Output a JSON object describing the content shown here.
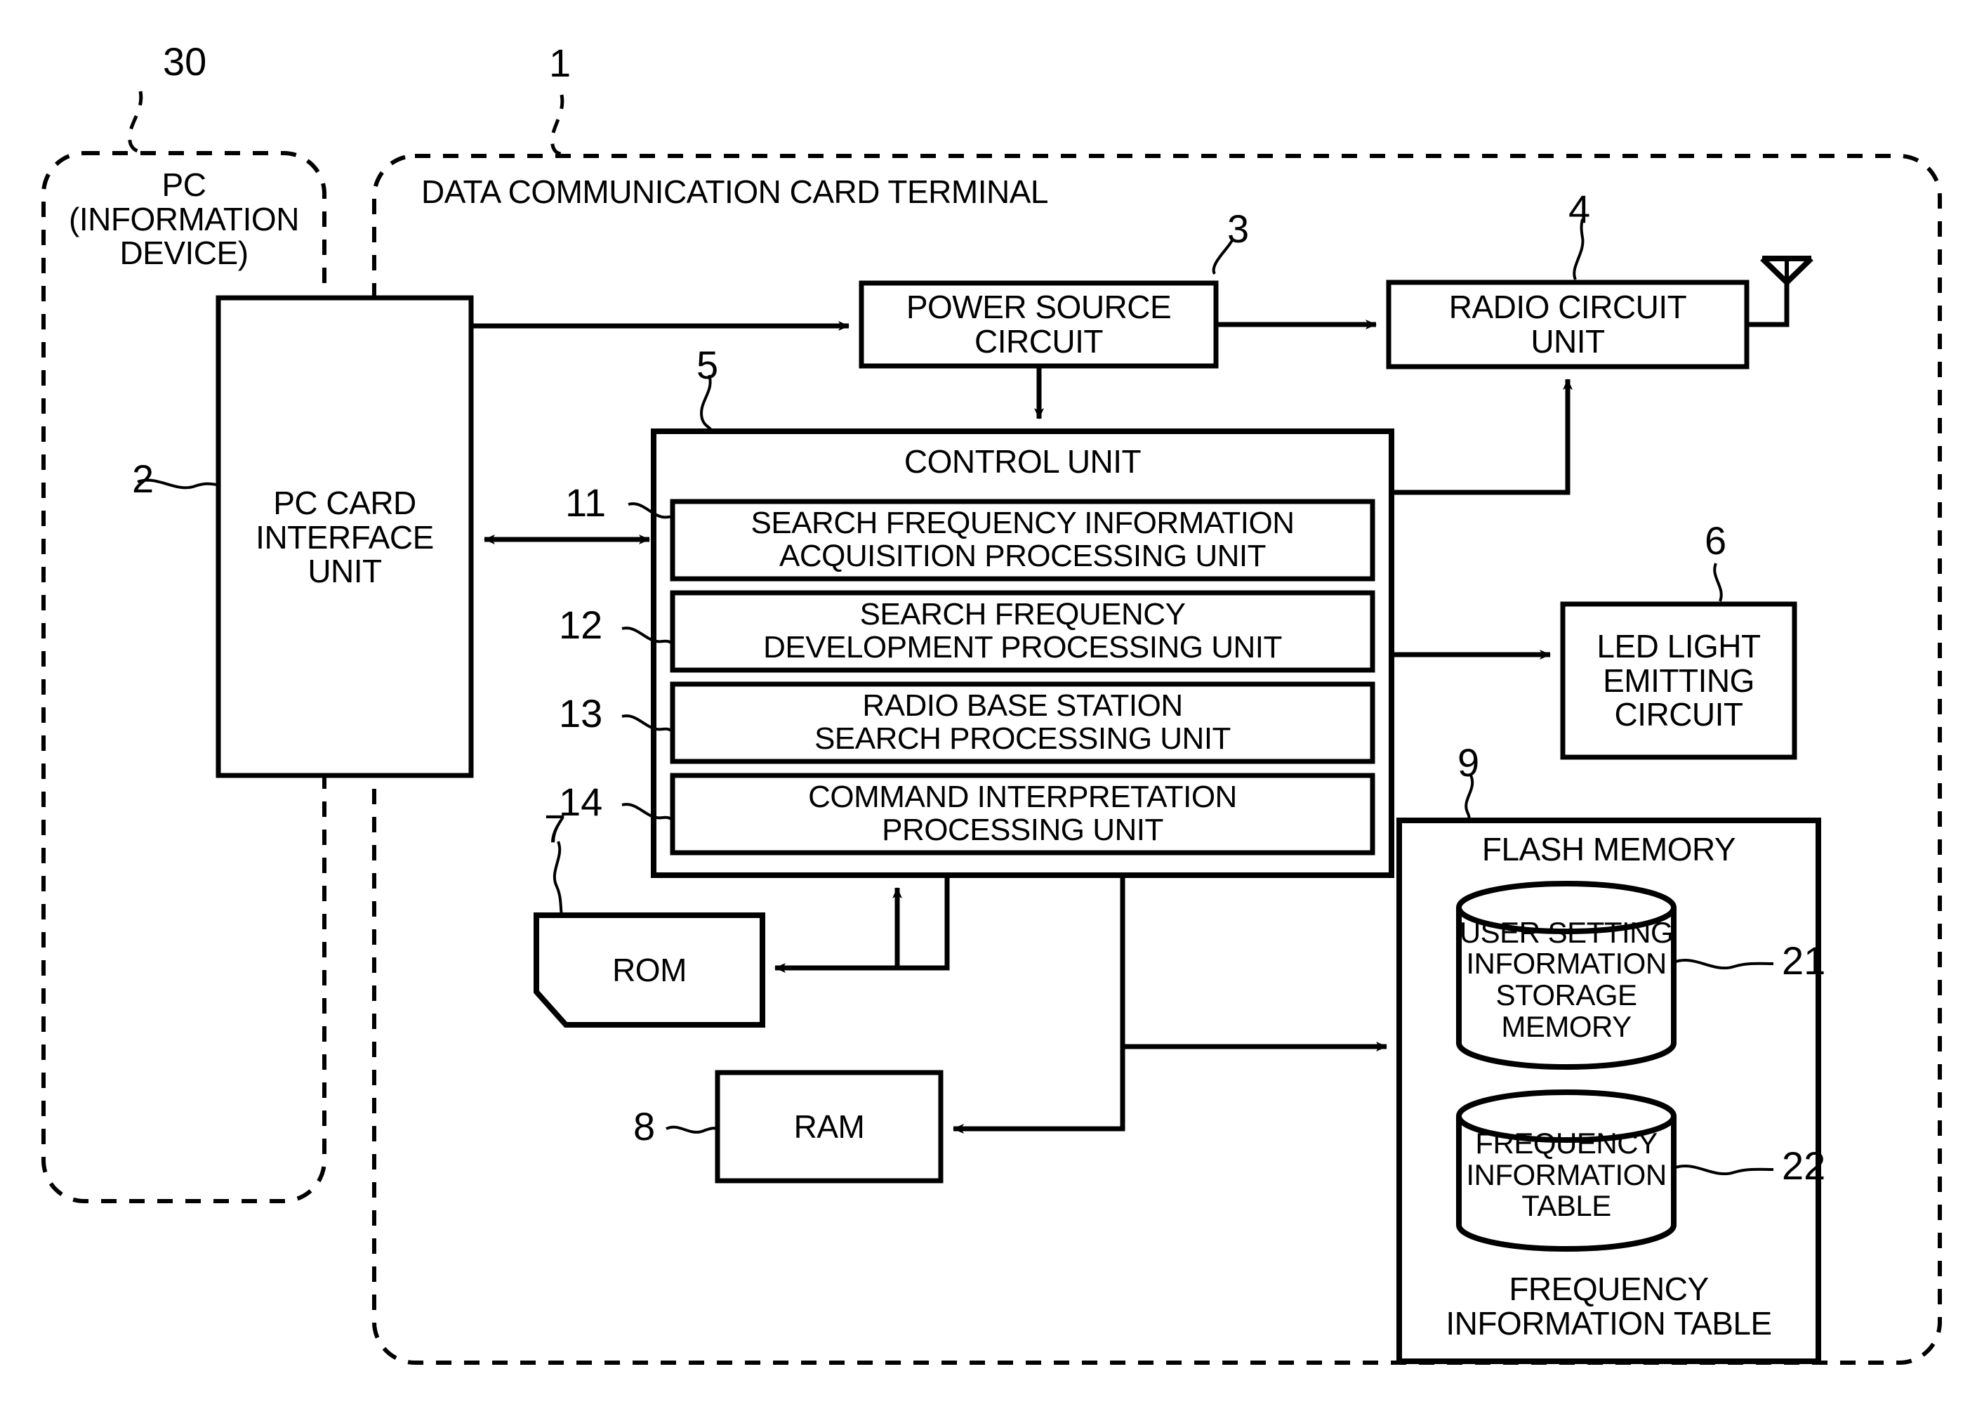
{
  "figure": {
    "type": "patent-block-diagram",
    "outer_groups": [
      {
        "ref": "30",
        "title": "PC\n(INFORMATION\nDEVICE)",
        "style": "dashed-rounded"
      },
      {
        "ref": "1",
        "title": "DATA COMMUNICATION CARD TERMINAL",
        "style": "dashed-rounded"
      }
    ],
    "blocks": [
      {
        "ref": "2",
        "label": "PC CARD\nINTERFACE\nUNIT",
        "shape": "rect"
      },
      {
        "ref": "3",
        "label": "POWER SOURCE\nCIRCUIT",
        "shape": "rect"
      },
      {
        "ref": "4",
        "label": "RADIO CIRCUIT\nUNIT",
        "shape": "rect"
      },
      {
        "ref": "5",
        "label": "CONTROL UNIT",
        "shape": "rect"
      },
      {
        "ref": "11",
        "label": "SEARCH FREQUENCY INFORMATION\nACQUISITION PROCESSING UNIT",
        "shape": "rect"
      },
      {
        "ref": "12",
        "label": "SEARCH FREQUENCY\nDEVELOPMENT PROCESSING UNIT",
        "shape": "rect"
      },
      {
        "ref": "13",
        "label": "RADIO BASE STATION\nSEARCH PROCESSING UNIT",
        "shape": "rect"
      },
      {
        "ref": "14",
        "label": "COMMAND INTERPRETATION\nPROCESSING UNIT",
        "shape": "rect"
      },
      {
        "ref": "6",
        "label": "LED LIGHT\nEMITTING\nCIRCUIT",
        "shape": "rect"
      },
      {
        "ref": "7",
        "label": "ROM",
        "shape": "notched-rect"
      },
      {
        "ref": "8",
        "label": "RAM",
        "shape": "rect"
      },
      {
        "ref": "9",
        "label": "FLASH MEMORY",
        "shape": "rect"
      },
      {
        "ref": "21",
        "label": "USER SETTING\nINFORMATION\nSTORAGE\nMEMORY",
        "shape": "cylinder"
      },
      {
        "ref": "22",
        "label": "FREQUENCY\nINFORMATION\nTABLE",
        "shape": "cylinder"
      }
    ],
    "captions": [
      {
        "name": "flash-memory-caption",
        "text": "FREQUENCY\nINFORMATION TABLE"
      }
    ],
    "icons": [
      {
        "name": "antenna-icon",
        "desc": "triangular whip antenna attached to radio circuit unit"
      }
    ],
    "colors": {
      "ink": "#000000",
      "paper": "#ffffff"
    }
  },
  "labels": {
    "pc_group_title": "PC\n(INFORMATION\nDEVICE)",
    "terminal_group_title": "DATA COMMUNICATION CARD TERMINAL",
    "pc_card_interface_unit": "PC CARD\nINTERFACE\nUNIT",
    "power_source_circuit": "POWER SOURCE\nCIRCUIT",
    "radio_circuit_unit": "RADIO CIRCUIT\nUNIT",
    "control_unit": "CONTROL UNIT",
    "search_freq_info_acq": "SEARCH FREQUENCY INFORMATION\nACQUISITION PROCESSING UNIT",
    "search_freq_dev": "SEARCH FREQUENCY\nDEVELOPMENT PROCESSING UNIT",
    "radio_base_station_search": "RADIO BASE STATION\nSEARCH PROCESSING UNIT",
    "command_interpretation": "COMMAND INTERPRETATION\nPROCESSING UNIT",
    "led_light_emitting_circuit": "LED LIGHT\nEMITTING\nCIRCUIT",
    "rom": "ROM",
    "ram": "RAM",
    "flash_memory": "FLASH MEMORY",
    "user_setting_info_storage_memory": "USER SETTING\nINFORMATION\nSTORAGE\nMEMORY",
    "frequency_information_table_cyl": "FREQUENCY\nINFORMATION\nTABLE",
    "frequency_information_table_caption": "FREQUENCY\nINFORMATION TABLE"
  },
  "refs": {
    "r30": "30",
    "r1": "1",
    "r2": "2",
    "r3": "3",
    "r4": "4",
    "r5": "5",
    "r6": "6",
    "r7": "7",
    "r8": "8",
    "r9": "9",
    "r11": "11",
    "r12": "12",
    "r13": "13",
    "r14": "14",
    "r21": "21",
    "r22": "22"
  }
}
